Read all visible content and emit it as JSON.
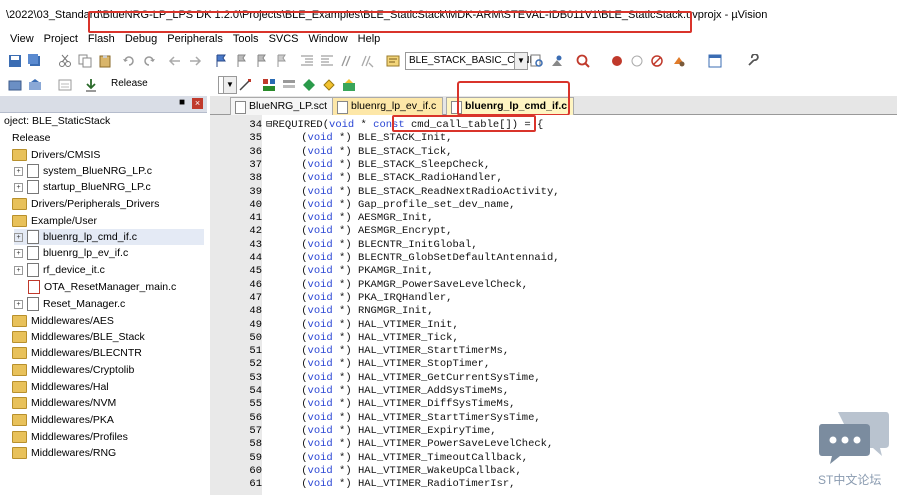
{
  "window": {
    "title": "\\2022\\03_Standard\\BlueNRG-LP_LPS DK 1.2.0\\Projects\\BLE_Examples\\BLE_StaticStack\\MDK-ARM\\STEVAL-IDB011V1\\BLE_StaticStack.uvprojx - µVision"
  },
  "menu": [
    "View",
    "Project",
    "Flash",
    "Debug",
    "Peripherals",
    "Tools",
    "SVCS",
    "Window",
    "Help"
  ],
  "toolbar": {
    "target_combo": "BLE_STACK_BASIC_CONF",
    "build_target": "Release"
  },
  "project_panel": {
    "root": "oject: BLE_StaticStack",
    "target": "Release",
    "items": [
      {
        "label": "Drivers/CMSIS",
        "type": "folder",
        "level": 1
      },
      {
        "label": "system_BlueNRG_LP.c",
        "type": "file",
        "level": 2
      },
      {
        "label": "startup_BlueNRG_LP.c",
        "type": "file",
        "level": 2
      },
      {
        "label": "Drivers/Peripherals_Drivers",
        "type": "folder",
        "level": 1
      },
      {
        "label": "Example/User",
        "type": "folder",
        "level": 1
      },
      {
        "label": "bluenrg_lp_cmd_if.c",
        "type": "file",
        "level": 2
      },
      {
        "label": "bluenrg_lp_ev_if.c",
        "type": "file",
        "level": 2
      },
      {
        "label": "rf_device_it.c",
        "type": "file",
        "level": 2
      },
      {
        "label": "OTA_ResetManager_main.c",
        "type": "file",
        "level": 2
      },
      {
        "label": "Reset_Manager.c",
        "type": "file",
        "level": 2
      },
      {
        "label": "Middlewares/AES",
        "type": "folder",
        "level": 1
      },
      {
        "label": "Middlewares/BLE_Stack",
        "type": "folder",
        "level": 1
      },
      {
        "label": "Middlewares/BLECNTR",
        "type": "folder",
        "level": 1
      },
      {
        "label": "Middlewares/Cryptolib",
        "type": "folder",
        "level": 1
      },
      {
        "label": "Middlewares/Hal",
        "type": "folder",
        "level": 1
      },
      {
        "label": "Middlewares/NVM",
        "type": "folder",
        "level": 1
      },
      {
        "label": "Middlewares/PKA",
        "type": "folder",
        "level": 1
      },
      {
        "label": "Middlewares/Profiles",
        "type": "folder",
        "level": 1
      },
      {
        "label": "Middlewares/RNG",
        "type": "folder",
        "level": 1
      }
    ]
  },
  "tabs": [
    "BlueNRG_LP.sct",
    "bluenrg_lp_ev_if.c",
    "bluenrg_lp_cmd_if.c"
  ],
  "code_lines": [
    {
      "n": "34",
      "text": "REQUIRED(void * const cmd_call_table[]) = {"
    },
    {
      "n": "35",
      "text": "    (void *) BLE_STACK_Init,"
    },
    {
      "n": "36",
      "text": "    (void *) BLE_STACK_Tick,"
    },
    {
      "n": "37",
      "text": "    (void *) BLE_STACK_SleepCheck,"
    },
    {
      "n": "38",
      "text": "    (void *) BLE_STACK_RadioHandler,"
    },
    {
      "n": "39",
      "text": "    (void *) BLE_STACK_ReadNextRadioActivity,"
    },
    {
      "n": "40",
      "text": "    (void *) Gap_profile_set_dev_name,"
    },
    {
      "n": "41",
      "text": "    (void *) AESMGR_Init,"
    },
    {
      "n": "42",
      "text": "    (void *) AESMGR_Encrypt,"
    },
    {
      "n": "43",
      "text": "    (void *) BLECNTR_InitGlobal,"
    },
    {
      "n": "44",
      "text": "    (void *) BLECNTR_GlobSetDefaultAntennaid,"
    },
    {
      "n": "45",
      "text": "    (void *) PKAMGR_Init,"
    },
    {
      "n": "46",
      "text": "    (void *) PKAMGR_PowerSaveLevelCheck,"
    },
    {
      "n": "47",
      "text": "    (void *) PKA_IRQHandler,"
    },
    {
      "n": "48",
      "text": "    (void *) RNGMGR_Init,"
    },
    {
      "n": "49",
      "text": "    (void *) HAL_VTIMER_Init,"
    },
    {
      "n": "50",
      "text": "    (void *) HAL_VTIMER_Tick,"
    },
    {
      "n": "51",
      "text": "    (void *) HAL_VTIMER_StartTimerMs,"
    },
    {
      "n": "52",
      "text": "    (void *) HAL_VTIMER_StopTimer,"
    },
    {
      "n": "53",
      "text": "    (void *) HAL_VTIMER_GetCurrentSysTime,"
    },
    {
      "n": "54",
      "text": "    (void *) HAL_VTIMER_AddSysTimeMs,"
    },
    {
      "n": "55",
      "text": "    (void *) HAL_VTIMER_DiffSysTimeMs,"
    },
    {
      "n": "56",
      "text": "    (void *) HAL_VTIMER_StartTimerSysTime,"
    },
    {
      "n": "57",
      "text": "    (void *) HAL_VTIMER_ExpiryTime,"
    },
    {
      "n": "58",
      "text": "    (void *) HAL_VTIMER_PowerSaveLevelCheck,"
    },
    {
      "n": "59",
      "text": "    (void *) HAL_VTIMER_TimeoutCallback,"
    },
    {
      "n": "60",
      "text": "    (void *) HAL_VTIMER_WakeUpCallback,"
    },
    {
      "n": "61",
      "text": "    (void *) HAL_VTIMER_RadioTimerIsr,"
    }
  ],
  "watermark": {
    "text": "ST中文论坛"
  },
  "colors": {
    "highlight_box": "#d9342b",
    "keyword": "#2a45d4",
    "folder": "#e8c15a"
  }
}
